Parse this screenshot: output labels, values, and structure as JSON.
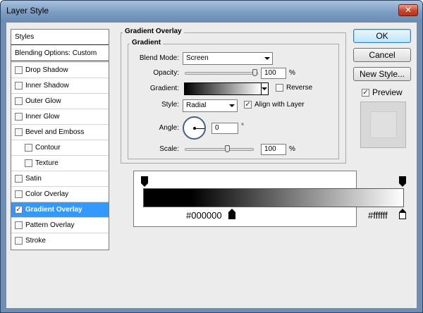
{
  "window": {
    "title": "Layer Style",
    "close_label": "✕"
  },
  "styles_list": {
    "header": "Styles",
    "blending_options": "Blending Options: Custom",
    "items": [
      {
        "label": "Drop Shadow",
        "checked": false,
        "indent": false,
        "selected": false
      },
      {
        "label": "Inner Shadow",
        "checked": false,
        "indent": false,
        "selected": false
      },
      {
        "label": "Outer Glow",
        "checked": false,
        "indent": false,
        "selected": false
      },
      {
        "label": "Inner Glow",
        "checked": false,
        "indent": false,
        "selected": false
      },
      {
        "label": "Bevel and Emboss",
        "checked": false,
        "indent": false,
        "selected": false
      },
      {
        "label": "Contour",
        "checked": false,
        "indent": true,
        "selected": false
      },
      {
        "label": "Texture",
        "checked": false,
        "indent": true,
        "selected": false
      },
      {
        "label": "Satin",
        "checked": false,
        "indent": false,
        "selected": false
      },
      {
        "label": "Color Overlay",
        "checked": false,
        "indent": false,
        "selected": false
      },
      {
        "label": "Gradient Overlay",
        "checked": true,
        "indent": false,
        "selected": true
      },
      {
        "label": "Pattern Overlay",
        "checked": false,
        "indent": false,
        "selected": false
      },
      {
        "label": "Stroke",
        "checked": false,
        "indent": false,
        "selected": false
      }
    ]
  },
  "gradient_overlay": {
    "section_title": "Gradient Overlay",
    "group_title": "Gradient",
    "blend_mode_label": "Blend Mode:",
    "blend_mode_value": "Screen",
    "opacity_label": "Opacity:",
    "opacity_value": "100",
    "opacity_fraction": 1.0,
    "opacity_unit": "%",
    "gradient_label": "Gradient:",
    "reverse_label": "Reverse",
    "reverse_checked": false,
    "style_label": "Style:",
    "style_value": "Radial",
    "align_label": "Align with Layer",
    "align_checked": true,
    "angle_label": "Angle:",
    "angle_value": "0",
    "angle_unit": "°",
    "scale_label": "Scale:",
    "scale_value": "100",
    "scale_fraction": 0.6,
    "scale_unit": "%"
  },
  "gradient_editor": {
    "start_color": "#000000",
    "end_color": "#ffffff",
    "start_label": "#000000",
    "end_label": "#ffffff"
  },
  "buttons": {
    "ok": "OK",
    "cancel": "Cancel",
    "new_style": "New Style...",
    "preview_label": "Preview",
    "preview_checked": true
  },
  "colors": {
    "accent_selection": "#3399ff",
    "titlebar": "#7c9cc2",
    "close_button": "#c8452a"
  }
}
